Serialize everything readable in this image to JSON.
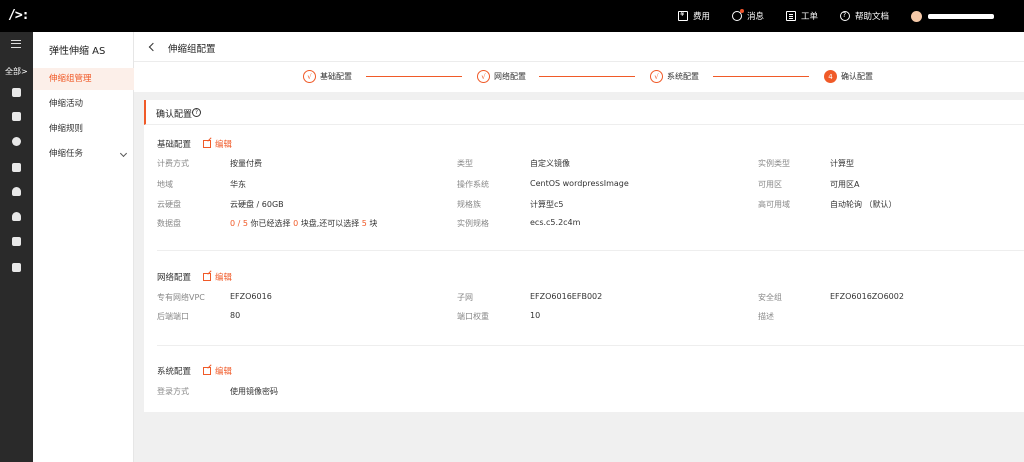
{
  "topbar": {
    "logo": "/>:",
    "nav": [
      {
        "label": "费用",
        "icon": "fee-icon"
      },
      {
        "label": "消息",
        "icon": "message-icon"
      },
      {
        "label": "工单",
        "icon": "ticket-icon"
      },
      {
        "label": "帮助文档",
        "icon": "help-icon"
      }
    ]
  },
  "rail": {
    "all_label": "全部>",
    "icons": [
      "cloud-server-icon",
      "database-icon",
      "network-icon",
      "storage-icon",
      "cloud-upload-icon",
      "cloud-icon",
      "security-icon",
      "database-stack-icon"
    ]
  },
  "sidebar": {
    "title": "弹性伸缩 AS",
    "items": [
      {
        "label": "伸缩组管理",
        "active": true
      },
      {
        "label": "伸缩活动",
        "active": false
      },
      {
        "label": "伸缩规则",
        "active": false
      },
      {
        "label": "伸缩任务",
        "active": false
      }
    ]
  },
  "header": {
    "title": "伸缩组配置"
  },
  "steps": [
    {
      "num": "√",
      "label": "基础配置"
    },
    {
      "num": "√",
      "label": "网络配置"
    },
    {
      "num": "√",
      "label": "系统配置"
    },
    {
      "num": "4",
      "label": "确认配置"
    }
  ],
  "card": {
    "title": "确认配置",
    "edit_label": "编辑",
    "basic": {
      "title": "基础配置",
      "rows": [
        [
          {
            "label": "计费方式",
            "value": "按量付费"
          },
          {
            "label": "类型",
            "value": "自定义镜像"
          },
          {
            "label": "实例类型",
            "value": "计算型"
          }
        ],
        [
          {
            "label": "地域",
            "value": "华东"
          },
          {
            "label": "操作系统",
            "value": "CentOS wordpressImage"
          },
          {
            "label": "可用区",
            "value": "可用区A"
          }
        ],
        [
          {
            "label": "云硬盘",
            "value": "云硬盘 / 60GB"
          },
          {
            "label": "规格族",
            "value": "计算型c5"
          },
          {
            "label": "高可用域",
            "value": "自动轮询 （默认）"
          }
        ]
      ],
      "data_disk": {
        "label": "数据盘",
        "used": "0",
        "sep": " / ",
        "total": "5",
        "text1": "  你已经选择 ",
        "selected": "0",
        "text2": " 块盘,还可以选择 ",
        "remain": "5",
        "text3": " 块"
      },
      "spec": {
        "label": "实例规格",
        "value": "ecs.c5.2c4m"
      }
    },
    "network": {
      "title": "网络配置",
      "rows": [
        [
          {
            "label": "专有网络VPC",
            "value": "EFZO6016"
          },
          {
            "label": "子网",
            "value": "EFZO6016EFB002"
          },
          {
            "label": "安全组",
            "value": "EFZO6016ZO6002"
          }
        ],
        [
          {
            "label": "后端端口",
            "value": "80"
          },
          {
            "label": "端口权重",
            "value": "10"
          },
          {
            "label": "描述",
            "value": ""
          }
        ]
      ]
    },
    "system": {
      "title": "系统配置",
      "login": {
        "label": "登录方式",
        "value": "使用镜像密码"
      }
    }
  },
  "colors": {
    "accent": "#f05a28",
    "topbar": "#000000",
    "rail": "#2a2a2a"
  }
}
